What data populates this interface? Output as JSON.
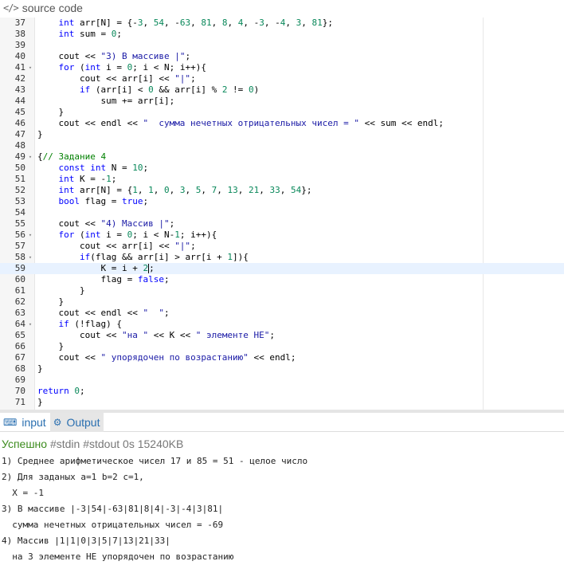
{
  "header": {
    "icon": "code-icon",
    "title": "source code"
  },
  "editor": {
    "active_line": 59,
    "lines": [
      {
        "n": "37",
        "fold": "",
        "code": "    int arr[N] = {-3, 54, -63, 81, 8, 4, -3, -4, 3, 81};"
      },
      {
        "n": "38",
        "fold": "",
        "code": "    int sum = 0;"
      },
      {
        "n": "39",
        "fold": "",
        "code": ""
      },
      {
        "n": "40",
        "fold": "",
        "code": "    cout << \"3) В массиве |\";"
      },
      {
        "n": "41",
        "fold": "▾",
        "code": "    for (int i = 0; i < N; i++){"
      },
      {
        "n": "42",
        "fold": "",
        "code": "        cout << arr[i] << \"|\";"
      },
      {
        "n": "43",
        "fold": "",
        "code": "        if (arr[i] < 0 && arr[i] % 2 != 0)"
      },
      {
        "n": "44",
        "fold": "",
        "code": "            sum += arr[i];"
      },
      {
        "n": "45",
        "fold": "",
        "code": "    }"
      },
      {
        "n": "46",
        "fold": "",
        "code": "    cout << endl << \"  сумма нечетных отрицательных чисел = \" << sum << endl;"
      },
      {
        "n": "47",
        "fold": "",
        "code": "}"
      },
      {
        "n": "48",
        "fold": "",
        "code": ""
      },
      {
        "n": "49",
        "fold": "▾",
        "code": "{// Задание 4"
      },
      {
        "n": "50",
        "fold": "",
        "code": "    const int N = 10;"
      },
      {
        "n": "51",
        "fold": "",
        "code": "    int K = -1;"
      },
      {
        "n": "52",
        "fold": "",
        "code": "    int arr[N] = {1, 1, 0, 3, 5, 7, 13, 21, 33, 54};"
      },
      {
        "n": "53",
        "fold": "",
        "code": "    bool flag = true;"
      },
      {
        "n": "54",
        "fold": "",
        "code": ""
      },
      {
        "n": "55",
        "fold": "",
        "code": "    cout << \"4) Массив |\";"
      },
      {
        "n": "56",
        "fold": "▾",
        "code": "    for (int i = 0; i < N-1; i++){"
      },
      {
        "n": "57",
        "fold": "",
        "code": "        cout << arr[i] << \"|\";"
      },
      {
        "n": "58",
        "fold": "▾",
        "code": "        if(flag && arr[i] > arr[i + 1]){"
      },
      {
        "n": "59",
        "fold": "",
        "code": "            K = i + 2;"
      },
      {
        "n": "60",
        "fold": "",
        "code": "            flag = false;"
      },
      {
        "n": "61",
        "fold": "",
        "code": "        }"
      },
      {
        "n": "62",
        "fold": "",
        "code": "    }"
      },
      {
        "n": "63",
        "fold": "",
        "code": "    cout << endl << \"  \";"
      },
      {
        "n": "64",
        "fold": "▾",
        "code": "    if (!flag) {"
      },
      {
        "n": "65",
        "fold": "",
        "code": "        cout << \"на \" << K << \" элементе НЕ\";"
      },
      {
        "n": "66",
        "fold": "",
        "code": "    }"
      },
      {
        "n": "67",
        "fold": "",
        "code": "    cout << \" упорядочен по возрастанию\" << endl;"
      },
      {
        "n": "68",
        "fold": "",
        "code": "}"
      },
      {
        "n": "69",
        "fold": "",
        "code": ""
      },
      {
        "n": "70",
        "fold": "",
        "code": "return 0;"
      },
      {
        "n": "71",
        "fold": "",
        "code": "}"
      }
    ]
  },
  "tabs": [
    {
      "icon": "input-icon",
      "glyph": "⌨",
      "label": "input",
      "active": false
    },
    {
      "icon": "gears-icon",
      "glyph": "⚙",
      "label": "Output",
      "active": true
    }
  ],
  "status": {
    "result": "Успешно",
    "tags": "#stdin #stdout",
    "time": "0s",
    "memory": "15240KB"
  },
  "output": [
    "1) Среднее арифметическое чисел 17 и 85 = 51 - целое число",
    "2) Для заданых a=1 b=2 c=1,",
    "  X = -1",
    "3) В массиве |-3|54|-63|81|8|4|-3|-4|3|81|",
    "  сумма нечетных отрицательных чисел = -69",
    "4) Массив |1|1|0|3|5|7|13|21|33|",
    "  на 3 элементе НЕ упорядочен по возрастанию"
  ]
}
